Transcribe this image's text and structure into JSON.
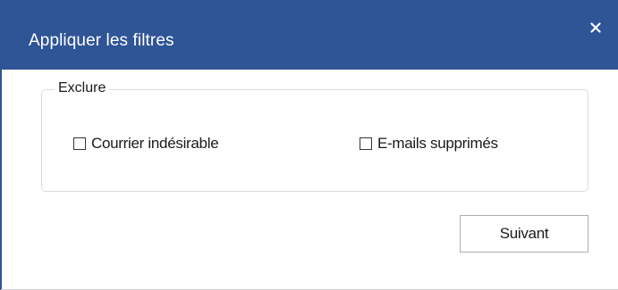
{
  "dialog": {
    "title": "Appliquer les filtres",
    "close_icon": "close-icon"
  },
  "exclude_group": {
    "legend": "Exclure",
    "options": [
      {
        "label": "Courrier indésirable",
        "checked": false
      },
      {
        "label": "E-mails supprimés",
        "checked": false
      }
    ]
  },
  "actions": {
    "next_label": "Suivant"
  },
  "colors": {
    "titlebar": "#2f5597",
    "title_text": "#ffffff",
    "content_bg": "#ffffff"
  }
}
